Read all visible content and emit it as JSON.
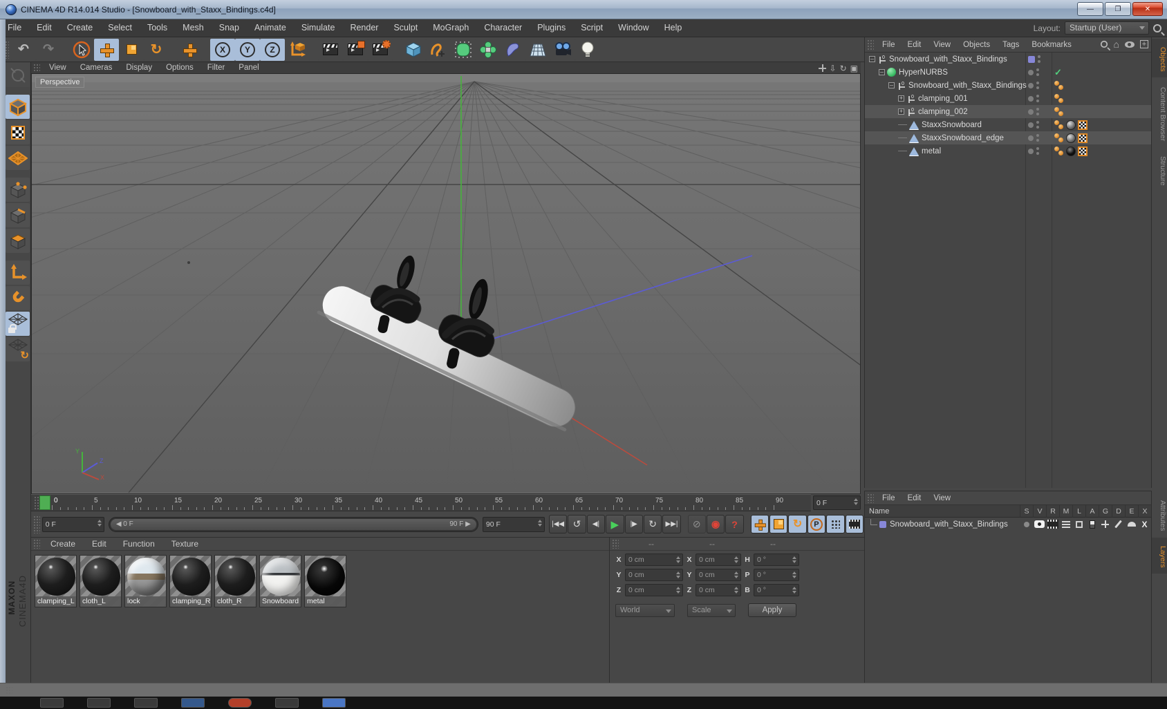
{
  "window": {
    "title": "CINEMA 4D R14.014 Studio - [Snowboard_with_Staxx_Bindings.c4d]"
  },
  "menubar": {
    "items": [
      "File",
      "Edit",
      "Create",
      "Select",
      "Tools",
      "Mesh",
      "Snap",
      "Animate",
      "Simulate",
      "Render",
      "Sculpt",
      "MoGraph",
      "Character",
      "Plugins",
      "Script",
      "Window",
      "Help"
    ],
    "layout_label": "Layout:",
    "layout_value": "Startup (User)"
  },
  "toolbar": {
    "buttons": [
      "undo",
      "redo",
      "live-selection",
      "move",
      "scale",
      "rotate",
      "last-tool-move",
      "lock-x-axis",
      "lock-y-axis",
      "lock-z-axis",
      "coordinate-system",
      "render-view",
      "render-to-picture-viewer",
      "render-settings",
      "add-cube",
      "add-spline",
      "add-hypernurbs",
      "add-mograph",
      "add-deformer",
      "add-environment",
      "add-camera",
      "add-light"
    ],
    "axis_letters": [
      "X",
      "Y",
      "Z"
    ]
  },
  "palette": {
    "buttons": [
      "make-editable",
      "model-mode",
      "texture-mode",
      "workplane-mode",
      "points-mode",
      "edges-mode",
      "polygons-mode",
      "enable-axis",
      "snap-magnet",
      "lock-workplane",
      "align-workplane"
    ]
  },
  "viewport": {
    "menu": [
      "View",
      "Cameras",
      "Display",
      "Options",
      "Filter",
      "Panel"
    ],
    "camera_label": "Perspective",
    "nav_icons": [
      "pan-icon",
      "zoom-icon",
      "rotate-icon",
      "toggle-view-icon"
    ],
    "gizmo_labels": {
      "x": "X",
      "y": "Y",
      "z": "Z"
    },
    "axis_colors": {
      "x": "#bb4b3d",
      "y": "#46b43c",
      "z": "#5b5bd6"
    }
  },
  "object_manager": {
    "menu": [
      "File",
      "Edit",
      "View",
      "Objects",
      "Tags",
      "Bookmarks"
    ],
    "corner_icons": [
      "search-icon",
      "home-icon",
      "eye-icon",
      "add-panel-icon"
    ],
    "tabs": [
      {
        "label": "Objects",
        "active": true
      },
      {
        "label": "Content Browser",
        "active": false
      },
      {
        "label": "Structure",
        "active": false
      }
    ],
    "tree": [
      {
        "name": "Snowboard_with_Staxx_Bindings",
        "depth": 0,
        "icon": "null",
        "expand": "minus",
        "chip": true,
        "check": false,
        "sel": false,
        "tags": []
      },
      {
        "name": "HyperNURBS",
        "depth": 1,
        "icon": "hypernurbs",
        "expand": "minus",
        "chip": false,
        "check": true,
        "sel": false,
        "tags": []
      },
      {
        "name": "Snowboard_with_Staxx_Bindings",
        "depth": 2,
        "icon": "null",
        "expand": "minus",
        "chip": false,
        "check": false,
        "sel": false,
        "tags": [
          "phong"
        ]
      },
      {
        "name": "clamping_001",
        "depth": 3,
        "icon": "null",
        "expand": "plus",
        "chip": false,
        "check": false,
        "sel": false,
        "tags": [
          "phong"
        ]
      },
      {
        "name": "clamping_002",
        "depth": 3,
        "icon": "null",
        "expand": "plus",
        "chip": false,
        "check": false,
        "sel": true,
        "tags": [
          "phong"
        ]
      },
      {
        "name": "StaxxSnowboard",
        "depth": 3,
        "icon": "polygon",
        "expand": null,
        "chip": false,
        "check": false,
        "sel": false,
        "tags": [
          "phong",
          "mat-gray",
          "uvw"
        ]
      },
      {
        "name": "StaxxSnowboard_edge",
        "depth": 3,
        "icon": "polygon",
        "expand": null,
        "chip": false,
        "check": false,
        "sel": true,
        "tags": [
          "phong",
          "mat-gray",
          "uvw"
        ]
      },
      {
        "name": "metal",
        "depth": 3,
        "icon": "polygon",
        "expand": null,
        "chip": false,
        "check": false,
        "sel": false,
        "tags": [
          "phong",
          "mat-black",
          "uvw"
        ]
      }
    ]
  },
  "timeline": {
    "tick_labels": [
      "0",
      "5",
      "10",
      "15",
      "20",
      "25",
      "30",
      "35",
      "40",
      "45",
      "50",
      "55",
      "60",
      "65",
      "70",
      "75",
      "80",
      "85",
      "90"
    ],
    "frames_total": 90,
    "current_frame_field": "0 F",
    "range_start": "0 F",
    "range_end": "90 F",
    "end_frame_field": "90 F",
    "playhead_color": "#4fae53",
    "transport": [
      "goto-start",
      "play-backwards",
      "previous-frame",
      "play-forwards",
      "next-frame",
      "play-loop",
      "goto-end"
    ],
    "record_buttons": [
      "mute",
      "record",
      "autokey-question"
    ],
    "key_toggles": [
      "key-position",
      "key-scale",
      "key-rotation",
      "key-parameter",
      "key-pla",
      "keyframe-selection"
    ]
  },
  "materials": {
    "menu": [
      "Create",
      "Edit",
      "Function",
      "Texture"
    ],
    "items": [
      {
        "name": "clamping_L",
        "look": "dark"
      },
      {
        "name": "cloth_L",
        "look": "dark"
      },
      {
        "name": "lock",
        "look": "chrome"
      },
      {
        "name": "clamping_R",
        "look": "dark"
      },
      {
        "name": "cloth_R",
        "look": "dark"
      },
      {
        "name": "Snowboard",
        "look": "twotone"
      },
      {
        "name": "metal",
        "look": "black"
      }
    ]
  },
  "coordinates": {
    "menu": [
      "--",
      "--",
      "--"
    ],
    "rows": [
      {
        "pos_label": "X",
        "pos": "0 cm",
        "size_label": "X",
        "size": "0 cm",
        "rot_label": "H",
        "rot": "0 °"
      },
      {
        "pos_label": "Y",
        "pos": "0 cm",
        "size_label": "Y",
        "size": "0 cm",
        "rot_label": "P",
        "rot": "0 °"
      },
      {
        "pos_label": "Z",
        "pos": "0 cm",
        "size_label": "Z",
        "size": "0 cm",
        "rot_label": "B",
        "rot": "0 °"
      }
    ],
    "world_dropdown": "World",
    "scale_dropdown": "Scale",
    "apply_button": "Apply"
  },
  "layers_panel": {
    "menu": [
      "File",
      "Edit",
      "View"
    ],
    "name_header": "Name",
    "columns": [
      "S",
      "V",
      "R",
      "M",
      "L",
      "A",
      "G",
      "D",
      "E",
      "X"
    ],
    "rows": [
      {
        "name": "Snowboard_with_Staxx_Bindings",
        "chip_color": "#8787d8"
      }
    ],
    "tabs": [
      {
        "label": "Attributes",
        "active": false
      },
      {
        "label": "Layers",
        "active": true
      }
    ]
  },
  "branding": {
    "maxon": "MAXON",
    "cinema": "CINEMA4D"
  },
  "colors": {
    "accent_orange": "#e8922a",
    "active_blue": "#a9bed9",
    "panel_bg": "#474747",
    "viewport_bg": "#6e6e6e",
    "layer_chip": "#8787d8",
    "check_green": "#52d07e"
  }
}
